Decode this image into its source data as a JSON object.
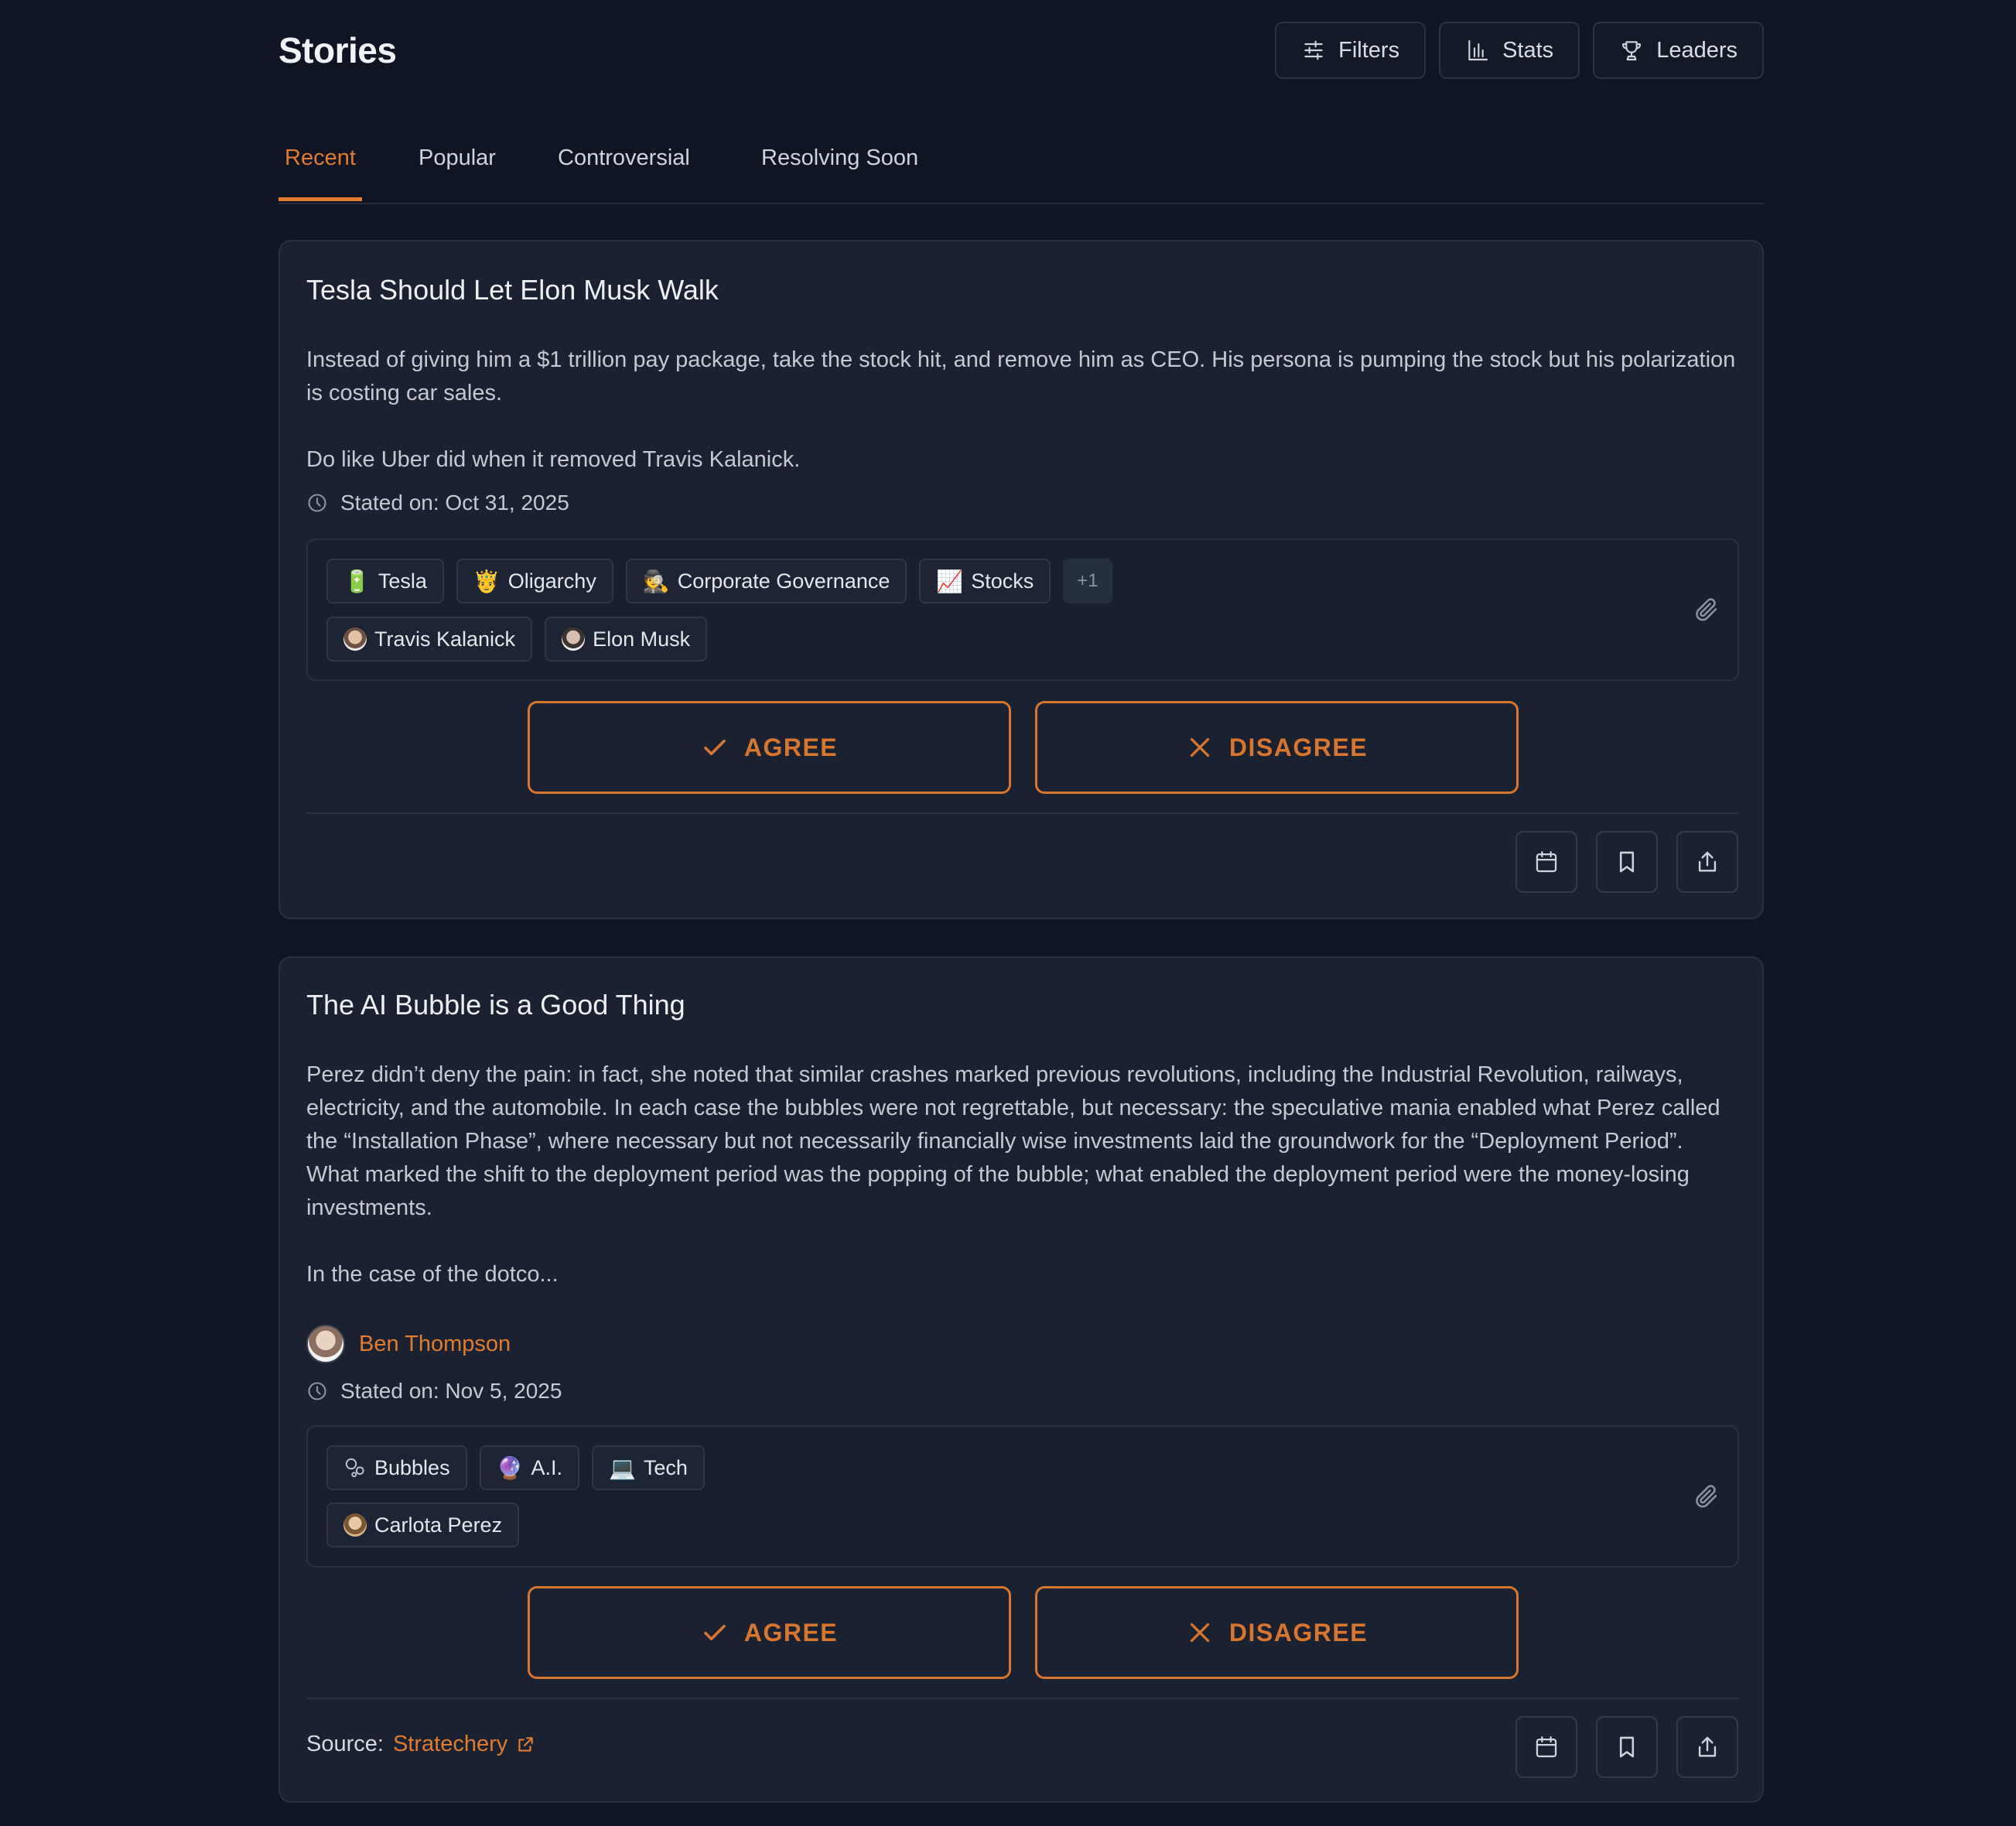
{
  "header": {
    "title": "Stories",
    "buttons": {
      "filters": "Filters",
      "stats": "Stats",
      "leaders": "Leaders"
    }
  },
  "tabs": [
    "Recent",
    "Popular",
    "Controversial",
    "Resolving Soon"
  ],
  "active_tab": "Recent",
  "accent_color": "#e07b2f",
  "stories": [
    {
      "title": "Tesla Should Let Elon Musk Walk",
      "paragraphs": [
        "Instead of giving him a $1 trillion pay package, take the stock hit, and remove him as CEO. His persona is pumping the stock but his polarization is costing car sales.",
        "Do like Uber did when it removed Travis Kalanick."
      ],
      "stated_on": "Stated on: Oct 31, 2025",
      "topics": [
        {
          "emoji": "🔋",
          "label": "Tesla"
        },
        {
          "emoji": "🤴",
          "label": "Oligarchy"
        },
        {
          "emoji": "🕵️",
          "label": "Corporate Governance"
        },
        {
          "emoji": "📈",
          "label": "Stocks"
        }
      ],
      "more_count": "+1",
      "people": [
        {
          "label": "Travis Kalanick"
        },
        {
          "label": "Elon Musk"
        }
      ],
      "agree_label": "AGREE",
      "disagree_label": "DISAGREE"
    },
    {
      "title": "The AI Bubble is a Good Thing",
      "paragraphs": [
        "Perez didn’t deny the pain: in fact, she noted that similar crashes marked previous revolutions, including the Industrial Revolution, railways, electricity, and the automobile. In each case the bubbles were not regrettable, but necessary: the speculative mania enabled what Perez called the “Installation Phase”, where necessary but not necessarily financially wise investments laid the groundwork for the “Deployment Period”. What marked the shift to the deployment period was the popping of the bubble; what enabled the deployment period were the money-losing investments.",
        "In the case of the dotco..."
      ],
      "author": "Ben Thompson",
      "stated_on": "Stated on: Nov 5, 2025",
      "topics": [
        {
          "emoji": "",
          "label": "Bubbles"
        },
        {
          "emoji": "🔮",
          "label": "A.I."
        },
        {
          "emoji": "💻",
          "label": "Tech"
        }
      ],
      "people": [
        {
          "label": "Carlota Perez"
        }
      ],
      "agree_label": "AGREE",
      "disagree_label": "DISAGREE",
      "source_label": "Source:",
      "source_name": "Stratechery"
    }
  ]
}
